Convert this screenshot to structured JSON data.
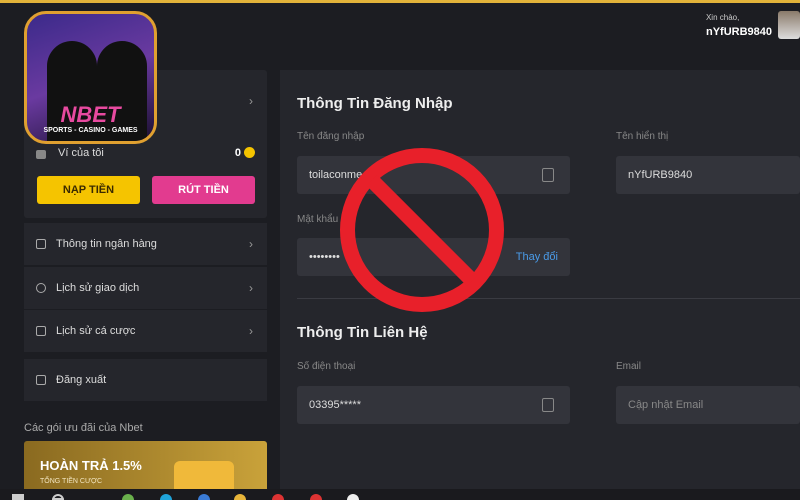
{
  "header": {
    "greeting": "Xin chào,",
    "username": "nYfURB9840"
  },
  "logo": {
    "brand": "NBET",
    "tagline": "SPORTS - CASINO - GAMES"
  },
  "wallet": {
    "label": "Ví của tôi",
    "balance": "0"
  },
  "buttons": {
    "deposit": "NẠP TIỀN",
    "withdraw": "RÚT TIỀN"
  },
  "sidebar": {
    "items": [
      {
        "label": "Thông tin ngân hàng"
      },
      {
        "label": "Lịch sử giao dịch"
      },
      {
        "label": "Lịch sử cá cược"
      },
      {
        "label": "Đăng xuất"
      }
    ]
  },
  "promo": {
    "heading": "Các gói ưu đãi của Nbet",
    "title": "HOÀN TRẢ 1.5%",
    "subtitle": "TỔNG TIỀN CƯỢC"
  },
  "login": {
    "title": "Thông Tin Đăng Nhập",
    "username_label": "Tên đăng nhập",
    "username_value": "toilaconme",
    "display_label": "Tên hiển thị",
    "display_value": "nYfURB9840",
    "password_label": "Mật khẩu",
    "password_value": "••••••••",
    "change": "Thay đổi"
  },
  "contact": {
    "title": "Thông Tin Liên Hệ",
    "phone_label": "Số điện thoại",
    "phone_value": "03395*****",
    "email_label": "Email",
    "email_placeholder": "Cập nhật Email"
  },
  "colors": {
    "accent": "#e2b33a",
    "deposit": "#f5c400",
    "withdraw": "#e23b8f",
    "link": "#4a9be8",
    "prohibit": "#e8202a"
  }
}
